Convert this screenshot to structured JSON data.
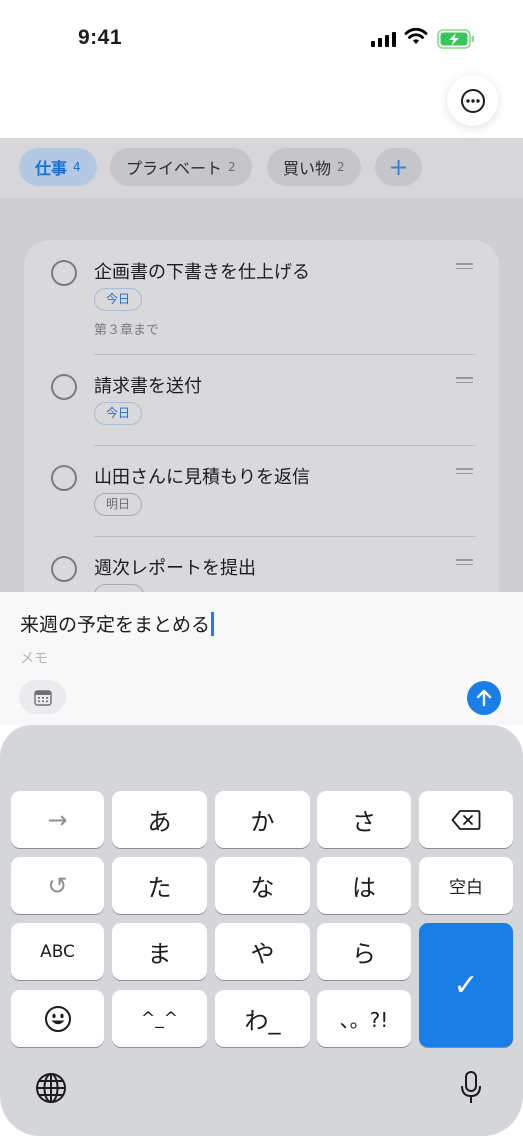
{
  "status_bar": {
    "time": "9:41"
  },
  "tabs": [
    {
      "label": "仕事",
      "count": "4"
    },
    {
      "label": "プライベート",
      "count": "2"
    },
    {
      "label": "買い物",
      "count": "2"
    }
  ],
  "add_tab_label": "+",
  "tasks": [
    {
      "title": "企画書の下書きを仕上げる",
      "due": "今日",
      "memo": "第３章まで"
    },
    {
      "title": "請求書を送付",
      "due": "今日"
    },
    {
      "title": "山田さんに見積もりを返信",
      "due": "明日"
    },
    {
      "title": "週次レポートを提出"
    }
  ],
  "composer": {
    "title_value": "来週の予定をまとめる",
    "memo_placeholder": "メモ"
  },
  "keyboard": {
    "row1": [
      "→",
      "あ",
      "か",
      "さ"
    ],
    "row2": [
      "た",
      "な",
      "は",
      "空白"
    ],
    "row3": [
      "ABC",
      "ま",
      "や",
      "ら"
    ],
    "row4": [
      "^_^",
      "わ_",
      "、。?!"
    ],
    "confirm_label": "✓",
    "undo_label": "↺",
    "backspace_icon": "delete-left",
    "emoji_icon": "smiley",
    "globe_icon": "globe",
    "mic_icon": "microphone"
  },
  "colors": {
    "accent": "#1a7ee8",
    "dim_overlay": "#cfcfd2"
  }
}
